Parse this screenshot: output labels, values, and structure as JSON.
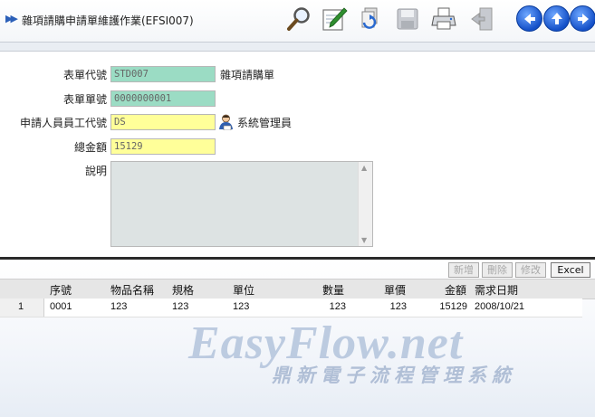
{
  "header": {
    "title": "雜項請購申請單維護作業(EFSI007)",
    "tools": [
      "search-icon",
      "edit-icon",
      "refresh-icon",
      "save-icon",
      "print-icon",
      "exit-icon"
    ],
    "nav": [
      "previous-icon",
      "up-icon",
      "next-icon"
    ]
  },
  "form": {
    "form_code_label": "表單代號",
    "form_code_value": "STD007",
    "form_code_desc": "雜項請購單",
    "form_no_label": "表單單號",
    "form_no_value": "0000000001",
    "applicant_label": "申請人員員工代號",
    "applicant_value": "DS",
    "applicant_name": "系統管理員",
    "total_label": "總金額",
    "total_value": "15129",
    "note_label": "說明",
    "note_value": ""
  },
  "grid": {
    "buttons": {
      "add": "新增",
      "delete": "刪除",
      "modify": "修改",
      "excel": "Excel"
    },
    "columns": [
      "序號",
      "物品名稱",
      "規格",
      "單位",
      "數量",
      "單價",
      "金額",
      "需求日期"
    ],
    "rows": [
      {
        "row": "1",
        "seq": "0001",
        "item": "123",
        "spec": "123",
        "unit": "123",
        "qty": "123",
        "price": "123",
        "amount": "15129",
        "date": "2008/10/21"
      }
    ]
  },
  "watermark": {
    "brand": "EasyFlow.net",
    "sub": "鼎新電子流程管理系統"
  }
}
